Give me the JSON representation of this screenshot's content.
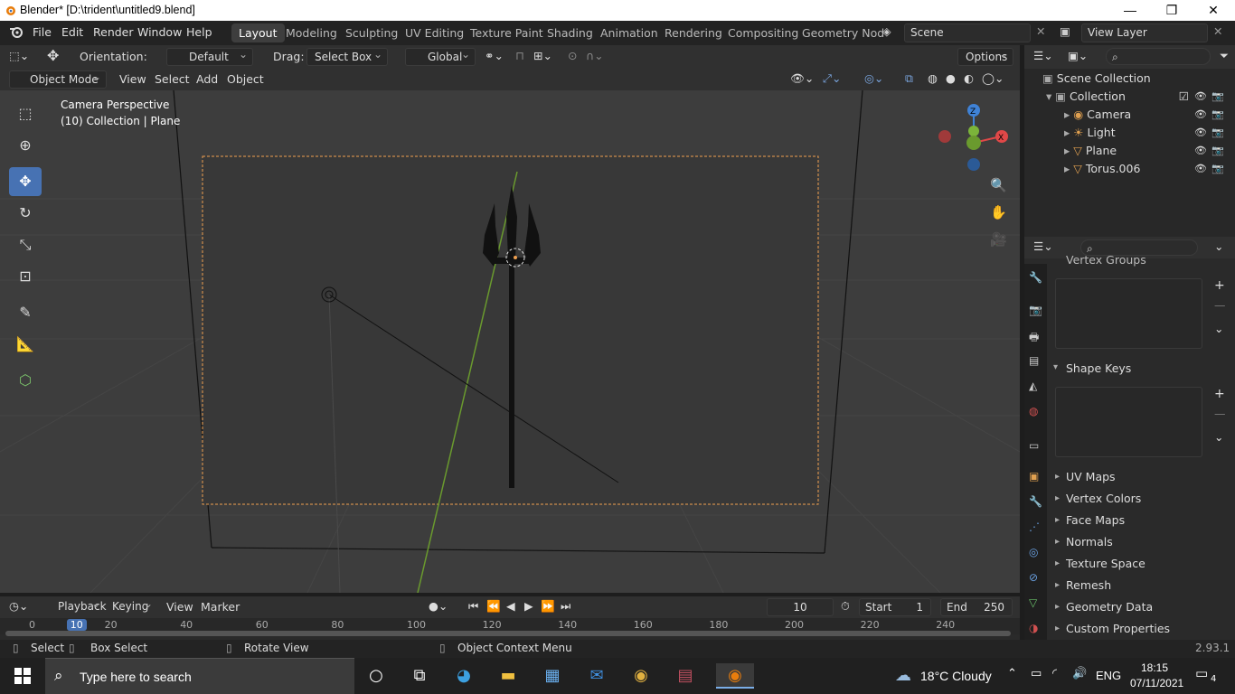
{
  "window": {
    "title": "Blender* [D:\\trident\\untitled9.blend]",
    "minimize": "—",
    "maximize": "❐",
    "close": "✕"
  },
  "menu": {
    "items": [
      "File",
      "Edit",
      "Render",
      "Window",
      "Help"
    ]
  },
  "workspaces": [
    {
      "label": "Layout",
      "active": true
    },
    {
      "label": "Modeling",
      "active": false
    },
    {
      "label": "Sculpting",
      "active": false
    },
    {
      "label": "UV Editing",
      "active": false
    },
    {
      "label": "Texture Paint",
      "active": false
    },
    {
      "label": "Shading",
      "active": false
    },
    {
      "label": "Animation",
      "active": false
    },
    {
      "label": "Rendering",
      "active": false
    },
    {
      "label": "Compositing",
      "active": false
    },
    {
      "label": "Geometry Nod",
      "active": false
    }
  ],
  "scene": {
    "name": "Scene"
  },
  "view_layer": {
    "name": "View Layer"
  },
  "tool_header": {
    "orientation_label": "Orientation:",
    "orientation_value": "Default",
    "drag_label": "Drag:",
    "drag_value": "Select Box",
    "transform_value": "Global",
    "options_label": "Options"
  },
  "viewport_header": {
    "mode": "Object Mode",
    "menus": [
      "View",
      "Select",
      "Add",
      "Object"
    ]
  },
  "viewport": {
    "overlay_line1": "Camera Perspective",
    "overlay_line2": "(10) Collection | Plane",
    "gizmo_z": "Z",
    "gizmo_y": "Y",
    "gizmo_x": "X"
  },
  "outliner": {
    "root": "Scene Collection",
    "collection": "Collection",
    "items": [
      {
        "name": "Camera",
        "icon": "camera-icon"
      },
      {
        "name": "Light",
        "icon": "light-icon"
      },
      {
        "name": "Plane",
        "icon": "mesh-icon"
      },
      {
        "name": "Torus.006",
        "icon": "mesh-icon"
      }
    ]
  },
  "properties": {
    "vertex_groups": "Vertex Groups",
    "shape_keys": "Shape Keys",
    "panels": [
      "UV Maps",
      "Vertex Colors",
      "Face Maps",
      "Normals",
      "Texture Space",
      "Remesh",
      "Geometry Data",
      "Custom Properties"
    ]
  },
  "timeline": {
    "menus": [
      "Playback",
      "Keying",
      "View",
      "Marker"
    ],
    "current_frame": "10",
    "start_label": "Start",
    "start_value": "1",
    "end_label": "End",
    "end_value": "250",
    "ruler_ticks": [
      "0",
      "10",
      "20",
      "40",
      "60",
      "80",
      "100",
      "120",
      "140",
      "160",
      "180",
      "200",
      "220",
      "240"
    ]
  },
  "statusbar": {
    "select": "Select",
    "box_select": "Box Select",
    "rotate_view": "Rotate View",
    "context_menu": "Object Context Menu",
    "version": "2.93.1"
  },
  "taskbar": {
    "search_placeholder": "Type here to search",
    "weather": "18°C  Cloudy",
    "language": "ENG",
    "time": "18:15",
    "date": "07/11/2021",
    "notifications": "4"
  },
  "colors": {
    "accent": "#4772b3",
    "active_outline": "#f0a050",
    "gizmo_x": "#e04848",
    "gizmo_y": "#7bb43a",
    "gizmo_z": "#3f82d6"
  }
}
